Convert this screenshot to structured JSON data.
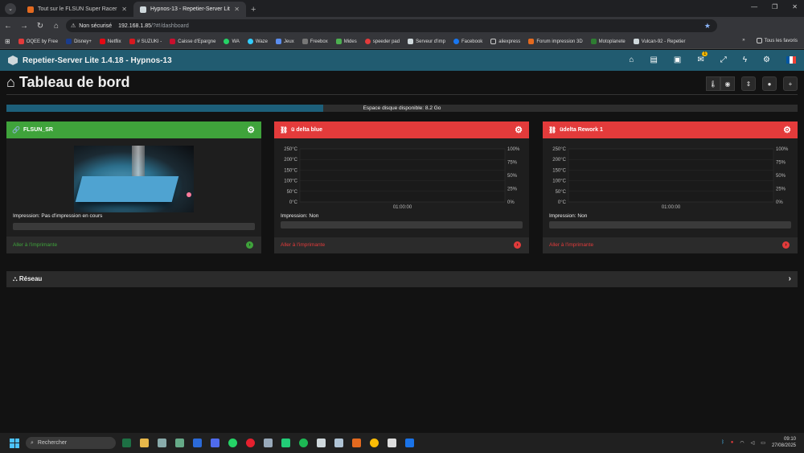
{
  "browser": {
    "tabs": [
      {
        "title": "Tout sur le FLSUN Super Racer",
        "active": false
      },
      {
        "title": "Hypnos-13 - Repetier-Server Lit",
        "active": true
      }
    ],
    "security_label": "Non sécurisé",
    "url_host": "192.168.1.85",
    "url_path": "/?#!/dashboard",
    "bookmarks": [
      "OQEE by Free",
      "Disney+",
      "Netflix",
      "# SUZUKI -",
      "Caisse d'Epargne",
      "WA",
      "Waze",
      "Jeux",
      "Freebox",
      "Mides",
      "speeder pad",
      "Serveur d'imp",
      "Facebook",
      "aliexpress",
      "Forum impression 3D",
      "Motoplanete",
      "Vulcan-92 - Repetier"
    ],
    "bookmarks_more": "»",
    "all_bookmarks": "Tous les favoris"
  },
  "app": {
    "title": "Repetier-Server Lite 1.4.18 - Hypnos-13",
    "message_count": "1"
  },
  "page": {
    "title": "Tableau de bord",
    "disk_label": "Espace disque disponible: 8.2 Go",
    "disk_used_fraction": 0.4
  },
  "printers": [
    {
      "name": "FLSUN_SR",
      "status": "Impression: Pas d'impression en cours",
      "link": "Aller à l'imprimante",
      "online": true
    },
    {
      "name": "ü delta blue",
      "status": "Impression: Non",
      "link": "Aller à l'imprimante",
      "online": false
    },
    {
      "name": "üdelta Rework 1",
      "status": "Impression: Non",
      "link": "Aller à l'imprimante",
      "online": false
    }
  ],
  "chart_data": [
    {
      "type": "line",
      "title": "",
      "y_left_ticks": [
        "250°C",
        "200°C",
        "150°C",
        "100°C",
        "50°C",
        "0°C"
      ],
      "y_right_ticks": [
        "100%",
        "75%",
        "50%",
        "25%",
        "0%"
      ],
      "x_ticks": [
        "01:00:00"
      ],
      "ylim": [
        0,
        250
      ],
      "series": []
    },
    {
      "type": "line",
      "title": "",
      "y_left_ticks": [
        "250°C",
        "200°C",
        "150°C",
        "100°C",
        "50°C",
        "0°C"
      ],
      "y_right_ticks": [
        "100%",
        "75%",
        "50%",
        "25%",
        "0%"
      ],
      "x_ticks": [
        "01:00:00"
      ],
      "ylim": [
        0,
        250
      ],
      "series": []
    }
  ],
  "network": {
    "label": "Réseau"
  },
  "taskbar": {
    "search_placeholder": "Rechercher",
    "time": "09:10",
    "date": "27/08/2025"
  },
  "colors": {
    "online": "#3fa33b",
    "offline": "#e33b3b",
    "appbar": "#215b70"
  }
}
